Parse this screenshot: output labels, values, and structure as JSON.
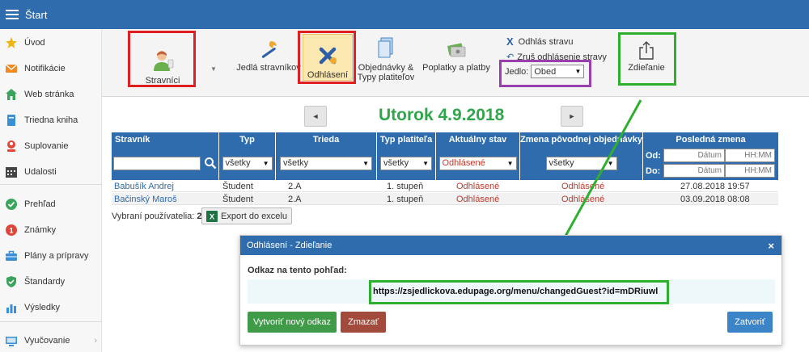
{
  "topbar": {
    "title": "Štart"
  },
  "sidebar": {
    "items": [
      {
        "label": "Úvod",
        "icon": "star-icon",
        "color": "#f1b40f"
      },
      {
        "label": "Notifikácie",
        "icon": "envelope-icon",
        "color": "#f08a24"
      },
      {
        "label": "Web stránka",
        "icon": "home-icon",
        "color": "#3aa35c"
      },
      {
        "label": "Triedna kniha",
        "icon": "book-icon",
        "color": "#3a8fd6"
      },
      {
        "label": "Suplovanie",
        "icon": "person-icon",
        "color": "#e0453a"
      },
      {
        "label": "Udalosti",
        "icon": "calendar-icon",
        "color": "#444444"
      },
      {
        "label": "Prehľad",
        "icon": "check-circle-icon",
        "color": "#3aa35c"
      },
      {
        "label": "Známky",
        "icon": "grade-icon",
        "color": "#e0453a"
      },
      {
        "label": "Plány a prípravy",
        "icon": "briefcase-icon",
        "color": "#3a8fd6"
      },
      {
        "label": "Štandardy",
        "icon": "shield-check-icon",
        "color": "#3aa35c"
      },
      {
        "label": "Výsledky",
        "icon": "bar-chart-icon",
        "color": "#3a8fd6"
      },
      {
        "label": "Vyučovanie",
        "icon": "monitor-icon",
        "color": "#3a8fd6"
      }
    ]
  },
  "toolbar": {
    "stravnici": "Stravníci",
    "jedla": "Jedlá stravníkov",
    "odhlaseni": "Odhlásení",
    "objednavky": "Objednávky &\nTypy platiteľov",
    "poplatky": "Poplatky a platby",
    "odhlas_stravu": "Odhlás stravu",
    "zrus": "Zruš odhlásenie stravy",
    "jedlo_label": "Jedlo:",
    "jedlo_value": "Obed",
    "zdielanie": "Zdieľanie"
  },
  "date_nav": {
    "title": "Utorok 4.9.2018",
    "prev": "◄",
    "next": "►"
  },
  "table": {
    "headers": [
      "Stravník",
      "Typ",
      "Trieda",
      "Typ platiteľa",
      "Aktuálny stav",
      "Zmena pôvodnej objednávky",
      "Posledná zmena"
    ],
    "filters": {
      "typ": "všetky",
      "trieda": "všetky",
      "typ_platitela": "všetky",
      "aktualny_stav": "Odhlásené",
      "zmena": "všetky",
      "od_label": "Od:",
      "do_label": "Do:",
      "datum_placeholder": "Dátum",
      "cas_placeholder": "HH:MM"
    },
    "rows": [
      {
        "name": "Babušík Andrej",
        "typ": "Študent",
        "trieda": "2.A",
        "platitel": "1. stupeň",
        "stav": "Odhlásené",
        "zmena": "Odhlásené",
        "posledna": "27.08.2018 19:57"
      },
      {
        "name": "Bačinský Maroš",
        "typ": "Študent",
        "trieda": "2.A",
        "platitel": "1. stupeň",
        "stav": "Odhlásené",
        "zmena": "Odhlásené",
        "posledna": "03.09.2018 08:08"
      }
    ]
  },
  "selection": {
    "label": "Vybraní používatelia:",
    "count": "2",
    "export": "Export do excelu"
  },
  "modal": {
    "title": "Odhlásení - Zdieľanie",
    "close": "×",
    "link_label": "Odkaz na tento pohľad:",
    "link": "https://zsjedlickova.edupage.org/menu/changedGuest?id=mDRiuwl",
    "btn_new": "Vytvoriť nový odkaz",
    "btn_delete": "Zmazať",
    "btn_close": "Zatvoriť"
  },
  "colors": {
    "primary": "#2e6cad",
    "highlight_red": "#e02020",
    "highlight_green": "#2eb02e",
    "highlight_purple": "#9b3fb0",
    "date_green": "#2fa64a"
  }
}
